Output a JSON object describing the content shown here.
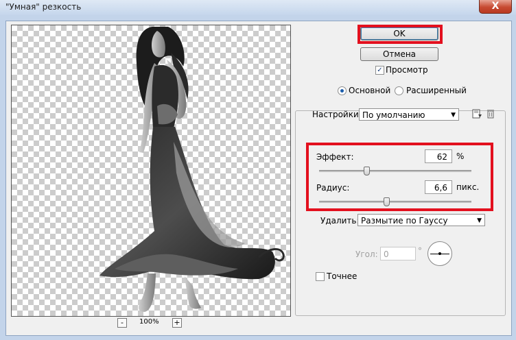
{
  "window": {
    "title": "\"Умная\" резкость",
    "close_label": "X"
  },
  "preview": {
    "zoom_level": "100%",
    "zoom_minus": "-",
    "zoom_plus": "+"
  },
  "buttons": {
    "ok": "OK",
    "cancel": "Отмена"
  },
  "preview_checkbox": {
    "label": "Просмотр",
    "checked": true,
    "mark": "✓"
  },
  "mode": {
    "basic": "Основной",
    "advanced": "Расширенный",
    "selected": "basic"
  },
  "settings": {
    "label": "Настройки:",
    "value": "По умолчанию",
    "arrow": "▼"
  },
  "amount": {
    "label": "Эффект:",
    "value": "62",
    "unit": "%",
    "slider_fraction": 0.31
  },
  "radius": {
    "label": "Радиус:",
    "value": "6,6",
    "unit": "пикс.",
    "slider_fraction": 0.44
  },
  "remove": {
    "label": "Удалить:",
    "value": "Размытие по Гауссу",
    "arrow": "▼"
  },
  "angle": {
    "label": "Угол:",
    "value": "0",
    "unit": "°"
  },
  "more_accurate": {
    "label": "Точнее",
    "checked": false
  },
  "colors": {
    "highlight": "#e3101e"
  }
}
